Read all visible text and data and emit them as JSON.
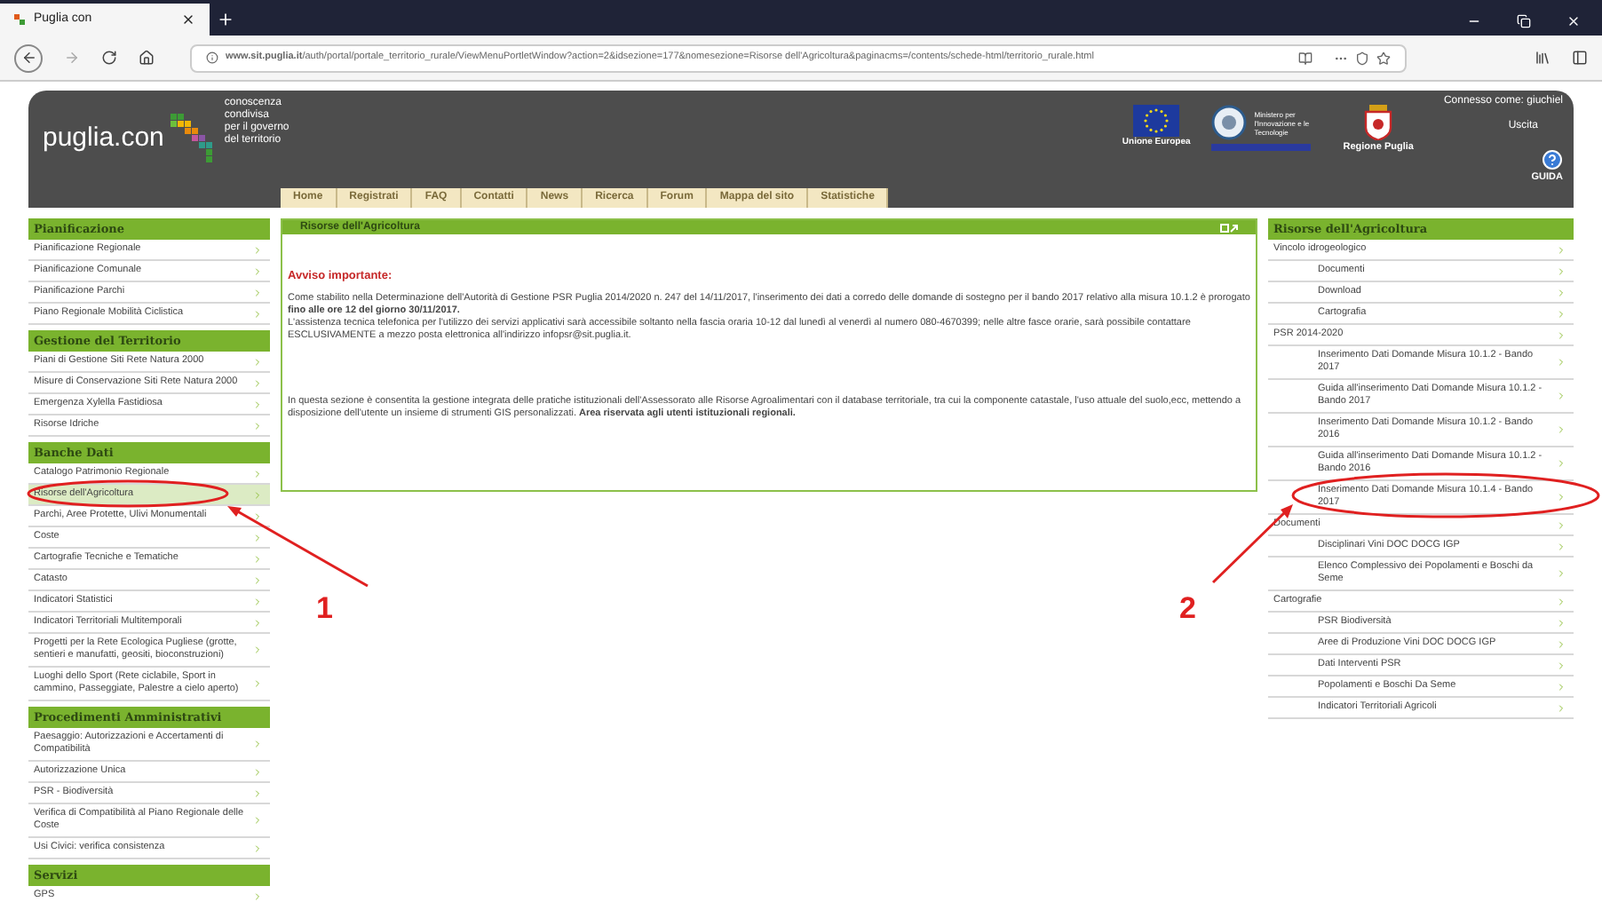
{
  "browser": {
    "tab_title": "Puglia con",
    "url": "**www.sit.puglia.it**/auth/portal/portale_territorio_rurale/ViewMenuPortletWindow?action=2&idsezione=177&nomesezione=Risorse dell'Agricoltura&paginacms=/contents/schede-html/territorio_rurale.html"
  },
  "header": {
    "logo": "puglia.con",
    "tagline": [
      "conoscenza",
      "condivisa",
      "per il governo",
      "del territorio"
    ],
    "nav": [
      {
        "label": "Home"
      },
      {
        "label": "Registrati"
      },
      {
        "label": "FAQ"
      },
      {
        "label": "Contatti"
      },
      {
        "label": "News"
      },
      {
        "label": "Ricerca"
      },
      {
        "label": "Forum"
      },
      {
        "label": "Mappa del sito"
      },
      {
        "label": "Statistiche"
      }
    ],
    "eu": "Unione Europea",
    "ministry": "Ministero per l'Innovazione e le Tecnologie",
    "region": "Regione Puglia",
    "user": "Connesso come: giuchiel",
    "logout": "Uscita",
    "help": "GUIDA"
  },
  "left_sidebar": [
    {
      "title": "Pianificazione",
      "items": [
        {
          "label": "Pianificazione Regionale",
          "selected": false
        },
        {
          "label": "Pianificazione Comunale",
          "selected": false
        },
        {
          "label": "Pianificazione Parchi",
          "selected": false
        },
        {
          "label": "Piano Regionale Mobilità Ciclistica",
          "selected": false
        }
      ]
    },
    {
      "title": "Gestione del Territorio",
      "items": [
        {
          "label": "Piani di Gestione Siti Rete Natura 2000",
          "selected": false
        },
        {
          "label": "Misure di Conservazione Siti Rete Natura 2000",
          "selected": false
        },
        {
          "label": "Emergenza Xylella Fastidiosa",
          "selected": false
        },
        {
          "label": "Risorse Idriche",
          "selected": false
        }
      ]
    },
    {
      "title": "Banche Dati",
      "items": [
        {
          "label": "Catalogo Patrimonio Regionale",
          "selected": false
        },
        {
          "label": "Risorse dell'Agricoltura",
          "selected": true
        },
        {
          "label": "Parchi, Aree Protette, Ulivi Monumentali",
          "selected": false
        },
        {
          "label": "Coste",
          "selected": false
        },
        {
          "label": "Cartografie Tecniche e Tematiche",
          "selected": false
        },
        {
          "label": "Catasto",
          "selected": false
        },
        {
          "label": "Indicatori Statistici",
          "selected": false
        },
        {
          "label": "Indicatori Territoriali Multitemporali",
          "selected": false
        },
        {
          "label": "Progetti per la Rete Ecologica Pugliese (grotte, sentieri e manufatti, geositi, bioconstruzioni)",
          "selected": false
        },
        {
          "label": "Luoghi dello Sport (Rete ciclabile, Sport in cammino, Passeggiate, Palestre a cielo aperto)",
          "selected": false
        }
      ]
    },
    {
      "title": "Procedimenti Amministrativi",
      "items": [
        {
          "label": "Paesaggio: Autorizzazioni e Accertamenti di Compatibilità",
          "selected": false
        },
        {
          "label": "Autorizzazione Unica",
          "selected": false
        },
        {
          "label": "PSR - Biodiversità",
          "selected": false
        },
        {
          "label": "Verifica di Compatibilità al Piano Regionale delle Coste",
          "selected": false
        },
        {
          "label": "Usi Civici: verifica consistenza",
          "selected": false
        }
      ]
    },
    {
      "title": "Servizi",
      "items": [
        {
          "label": "GPS",
          "selected": false
        }
      ]
    }
  ],
  "main_panel": {
    "title": "Risorse dell'Agricoltura",
    "notice_title": "Avviso importante:",
    "paragraphs": [
      "Come stabilito nella Determinazione dell'Autorità di Gestione PSR Puglia 2014/2020 n. 247 del 14/11/2017, l'inserimento dei dati a corredo delle domande di sostegno per il bando 2017 relativo alla misura 10.1.2 è prorogato **fino alle ore 12 del giorno 30/11/2017.**",
      "L'assistenza tecnica telefonica per l'utilizzo dei servizi applicativi sarà accessibile soltanto nella fascia oraria 10-12 dal lunedì al venerdì al numero 080-4670399; nelle altre fasce orarie, sarà possibile contattare ESCLUSIVAMENTE a mezzo posta elettronica all'indirizzo infopsr@sit.puglia.it.",
      "In questa sezione è consentita la gestione integrata delle pratiche istituzionali dell'Assessorato alle Risorse Agroalimentari con il database territoriale, tra cui la componente catastale, l'uso attuale del suolo,ecc, mettendo a disposizione dell'utente un insieme di strumenti GIS personalizzati. **Area riservata agli utenti istituzionali regionali.**"
    ]
  },
  "right_sidebar": {
    "title": "Risorse dell'Agricoltura",
    "items": [
      {
        "label": "Vincolo idrogeologico",
        "children": [
          {
            "label": "Documenti"
          },
          {
            "label": "Download"
          },
          {
            "label": "Cartografia"
          }
        ]
      },
      {
        "label": "PSR 2014-2020",
        "children": [
          {
            "label": "Inserimento Dati Domande Misura 10.1.2 - Bando 2017"
          },
          {
            "label": "Guida all'inserimento Dati Domande Misura 10.1.2 - Bando 2017"
          },
          {
            "label": "Inserimento Dati Domande Misura 10.1.2 - Bando 2016"
          },
          {
            "label": "Guida all'inserimento Dati Domande Misura 10.1.2 - Bando 2016"
          },
          {
            "label": "Inserimento Dati Domande Misura 10.1.4 - Bando 2017"
          }
        ]
      },
      {
        "label": "Documenti",
        "children": [
          {
            "label": "Disciplinari Vini DOC DOCG IGP"
          },
          {
            "label": "Elenco Complessivo dei Popolamenti e Boschi da Seme"
          }
        ]
      },
      {
        "label": "Cartografie",
        "children": [
          {
            "label": "PSR Biodiversità"
          },
          {
            "label": "Aree di Produzione Vini DOC DOCG IGP"
          },
          {
            "label": "Dati Interventi PSR"
          },
          {
            "label": "Popolamenti e Boschi Da Seme"
          },
          {
            "label": "Indicatori Territoriali Agricoli"
          }
        ]
      }
    ]
  },
  "annotations": [
    {
      "label": "1"
    },
    {
      "label": "2"
    }
  ]
}
